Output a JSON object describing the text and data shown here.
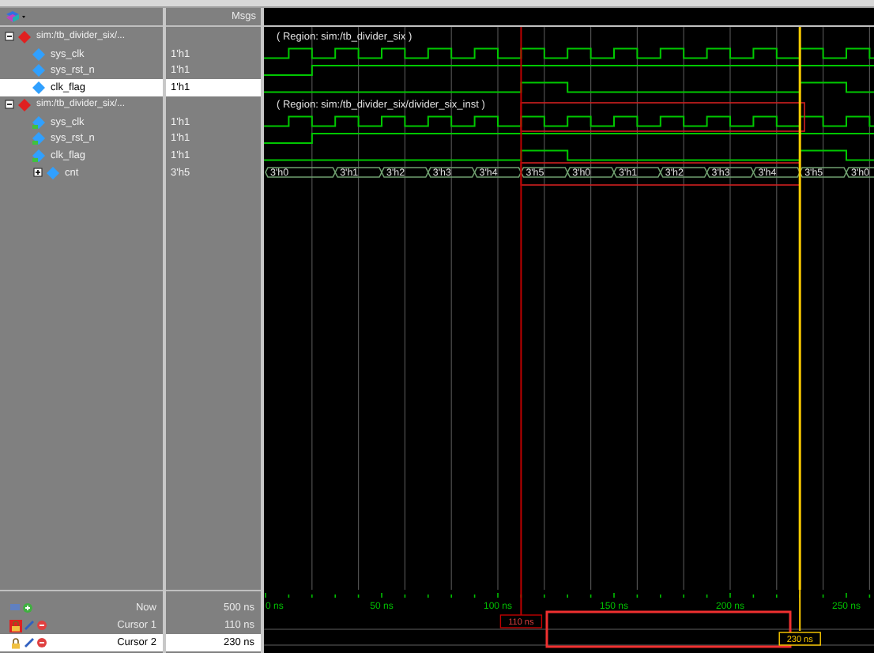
{
  "header": {
    "value_column": "Msgs"
  },
  "signals": [
    {
      "name": "sim:/tb_divider_six/...",
      "kind": "group",
      "expanded": true,
      "selected": false,
      "region": "( Region: sim:/tb_divider_six )",
      "children": [
        {
          "name": "sys_clk",
          "kind": "clock",
          "port": false,
          "value": "1'h1",
          "selected": false
        },
        {
          "name": "sys_rst_n",
          "kind": "reset",
          "port": false,
          "value": "1'h1",
          "selected": false
        },
        {
          "name": "clk_flag",
          "kind": "flag",
          "port": false,
          "value": "1'h1",
          "selected": true
        }
      ]
    },
    {
      "name": "sim:/tb_divider_six/...",
      "kind": "group",
      "expanded": true,
      "selected": false,
      "region": "( Region: sim:/tb_divider_six/divider_six_inst )",
      "children": [
        {
          "name": "sys_clk",
          "kind": "clock",
          "port": true,
          "value": "1'h1",
          "selected": false
        },
        {
          "name": "sys_rst_n",
          "kind": "reset",
          "port": true,
          "value": "1'h1",
          "selected": false
        },
        {
          "name": "clk_flag",
          "kind": "flag",
          "port": true,
          "value": "1'h1",
          "selected": false
        },
        {
          "name": "cnt",
          "kind": "bus",
          "port": false,
          "expanded": false,
          "value": "3'h5",
          "selected": false,
          "segments": [
            "3'h0",
            "3'h1",
            "3'h2",
            "3'h3",
            "3'h4",
            "3'h5",
            "3'h0",
            "3'h1",
            "3'h2",
            "3'h3",
            "3'h4",
            "3'h5",
            "3'h0"
          ]
        }
      ]
    }
  ],
  "cursors": [
    {
      "label": "Now",
      "value": "500 ns",
      "kind": "now",
      "selected": false
    },
    {
      "label": "Cursor 1",
      "value": "110 ns",
      "kind": "cursor",
      "locked": true,
      "selected": false,
      "tag": "110 ns"
    },
    {
      "label": "Cursor 2",
      "value": "230 ns",
      "kind": "cursor",
      "locked": false,
      "selected": true,
      "tag": "230 ns"
    }
  ],
  "ruler": [
    "0 ns",
    "50 ns",
    "100 ns",
    "150 ns",
    "200 ns",
    "250 ns"
  ]
}
